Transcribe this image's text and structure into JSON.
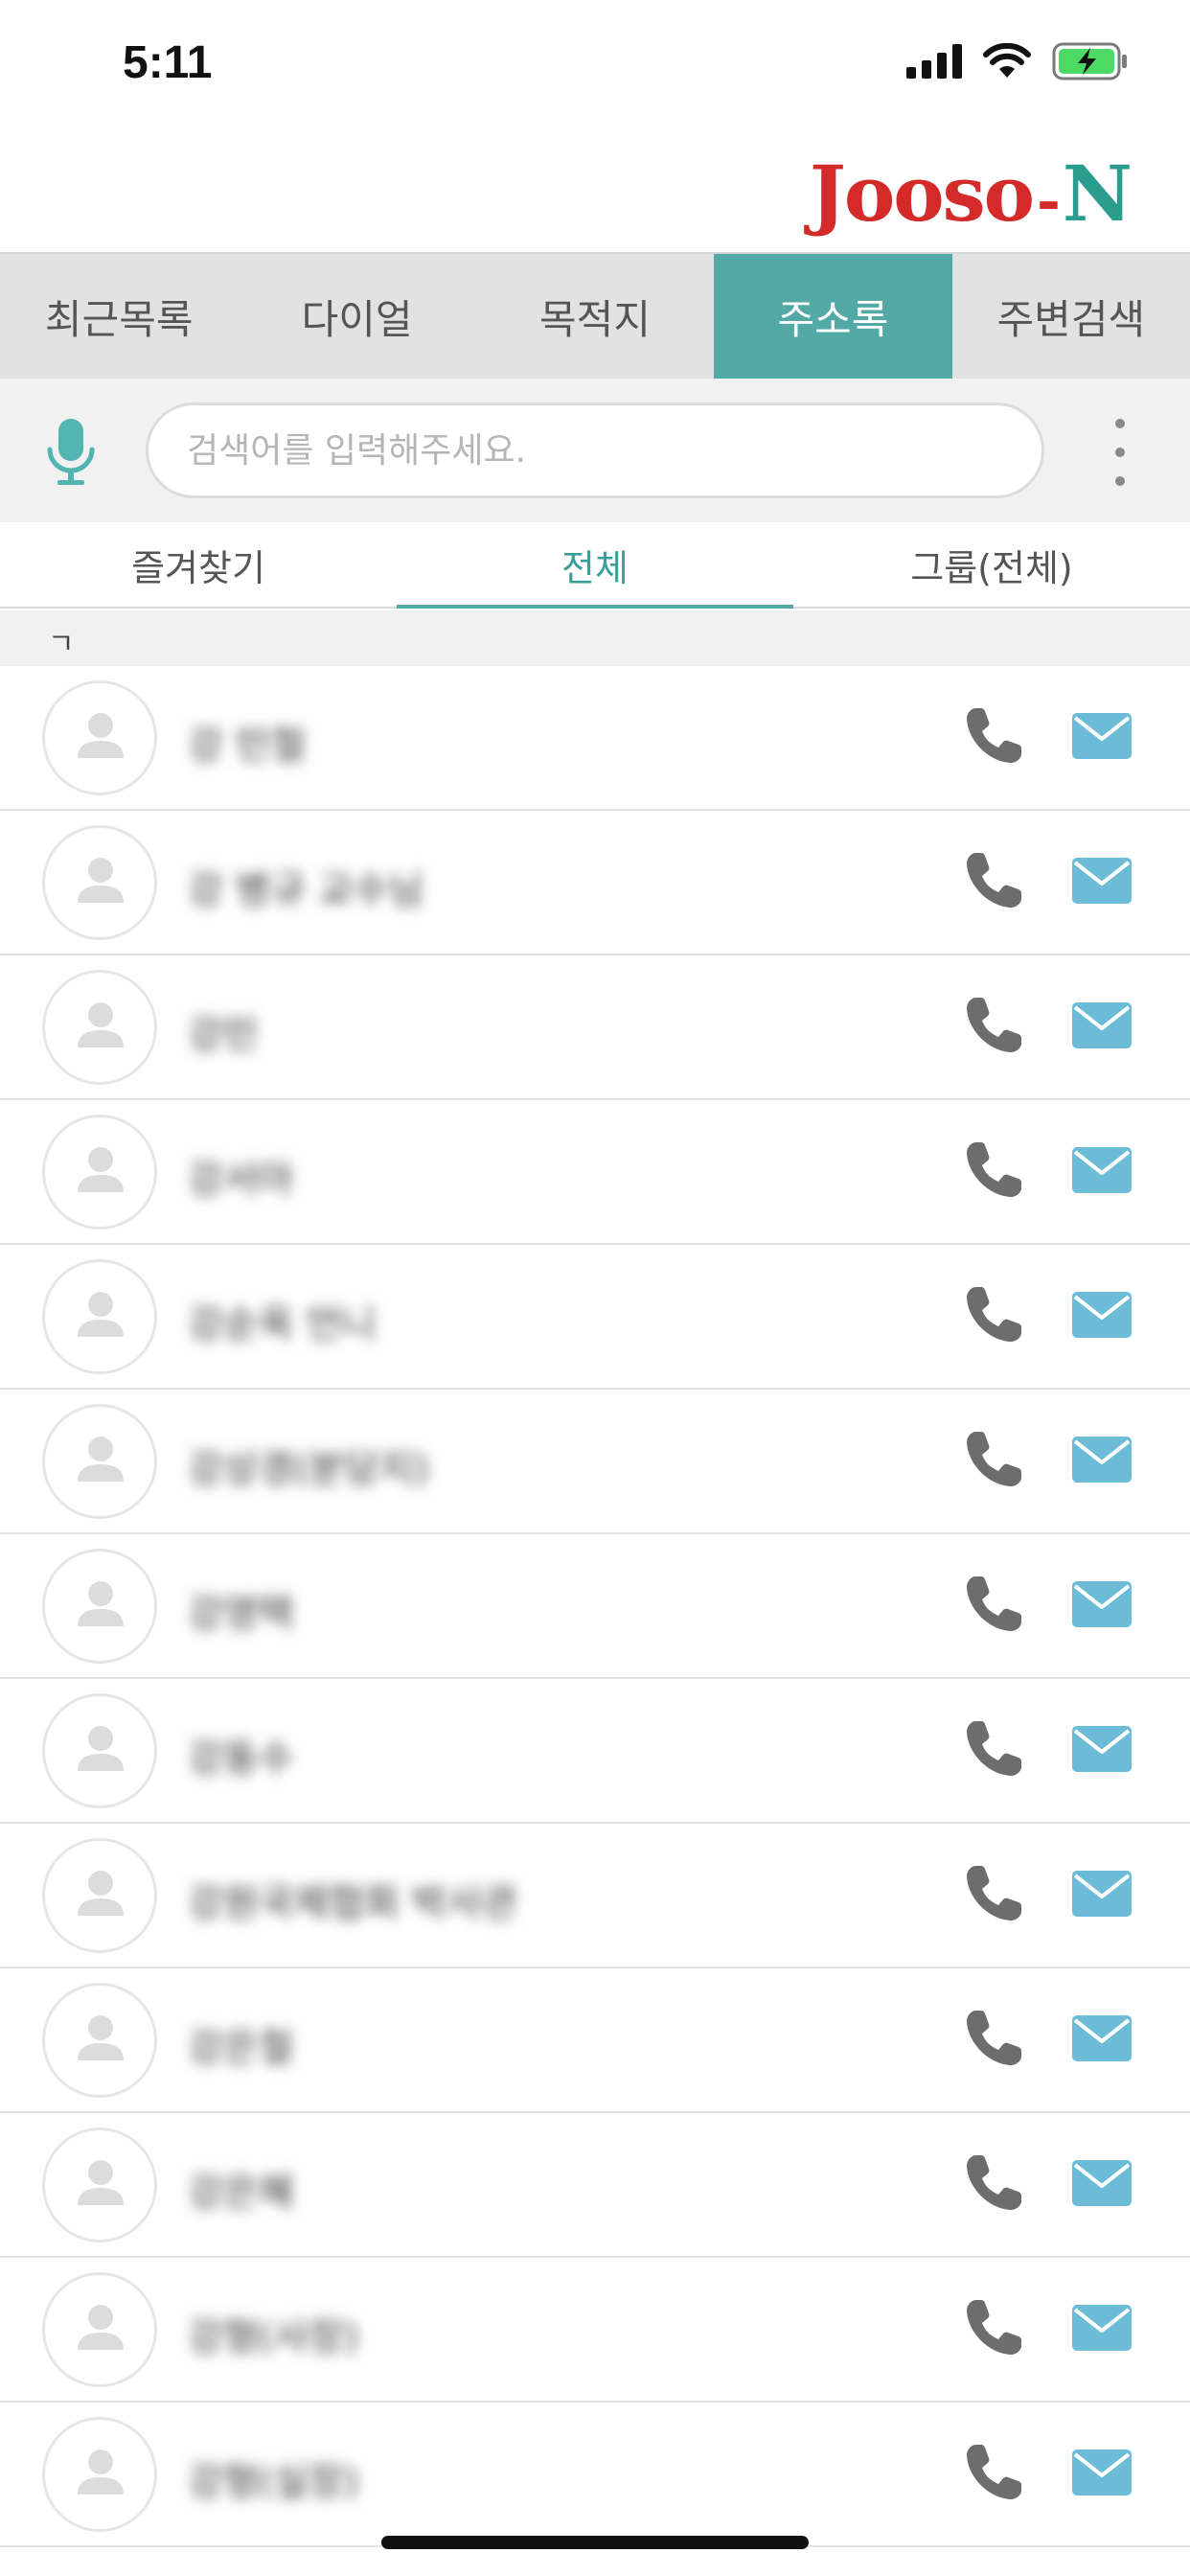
{
  "status_bar": {
    "time": "5:11"
  },
  "header": {
    "logo_part1": "Jooso",
    "logo_dash": "-",
    "logo_part2": "N"
  },
  "main_tabs": [
    {
      "label": "최근목록"
    },
    {
      "label": "다이얼"
    },
    {
      "label": "목적지"
    },
    {
      "label": "주소록"
    },
    {
      "label": "주변검색"
    }
  ],
  "active_main_tab": "주소록",
  "search": {
    "placeholder": "검색어를 입력해주세요.",
    "value": ""
  },
  "sub_tabs": [
    {
      "label": "즐겨찾기"
    },
    {
      "label": "전체"
    },
    {
      "label": "그룹(전체)"
    }
  ],
  "active_sub_tab": "전체",
  "section": {
    "header": "ㄱ"
  },
  "contacts": [
    {
      "name": "강 민철"
    },
    {
      "name": "강 병규 교수님"
    },
    {
      "name": "강민"
    },
    {
      "name": "강서아"
    },
    {
      "name": "강순옥 언니"
    },
    {
      "name": "강상경(분당지)"
    },
    {
      "name": "강영택"
    },
    {
      "name": "강동수"
    },
    {
      "name": "강원국제협회 박사관"
    },
    {
      "name": "강은철"
    },
    {
      "name": "강은혜"
    },
    {
      "name": "강형(사장)"
    },
    {
      "name": "강형(실장)"
    }
  ],
  "colors": {
    "accent": "#52a9a5",
    "logo_red": "#d42a2a",
    "logo_green": "#2a9d8f",
    "mail_icon": "#6cbcd8",
    "phone_icon": "#6d6d6d"
  },
  "icons": {
    "mic": "microphone-icon",
    "more": "more-vertical-icon",
    "call": "phone-icon",
    "mail": "mail-icon",
    "avatar": "person-icon"
  }
}
